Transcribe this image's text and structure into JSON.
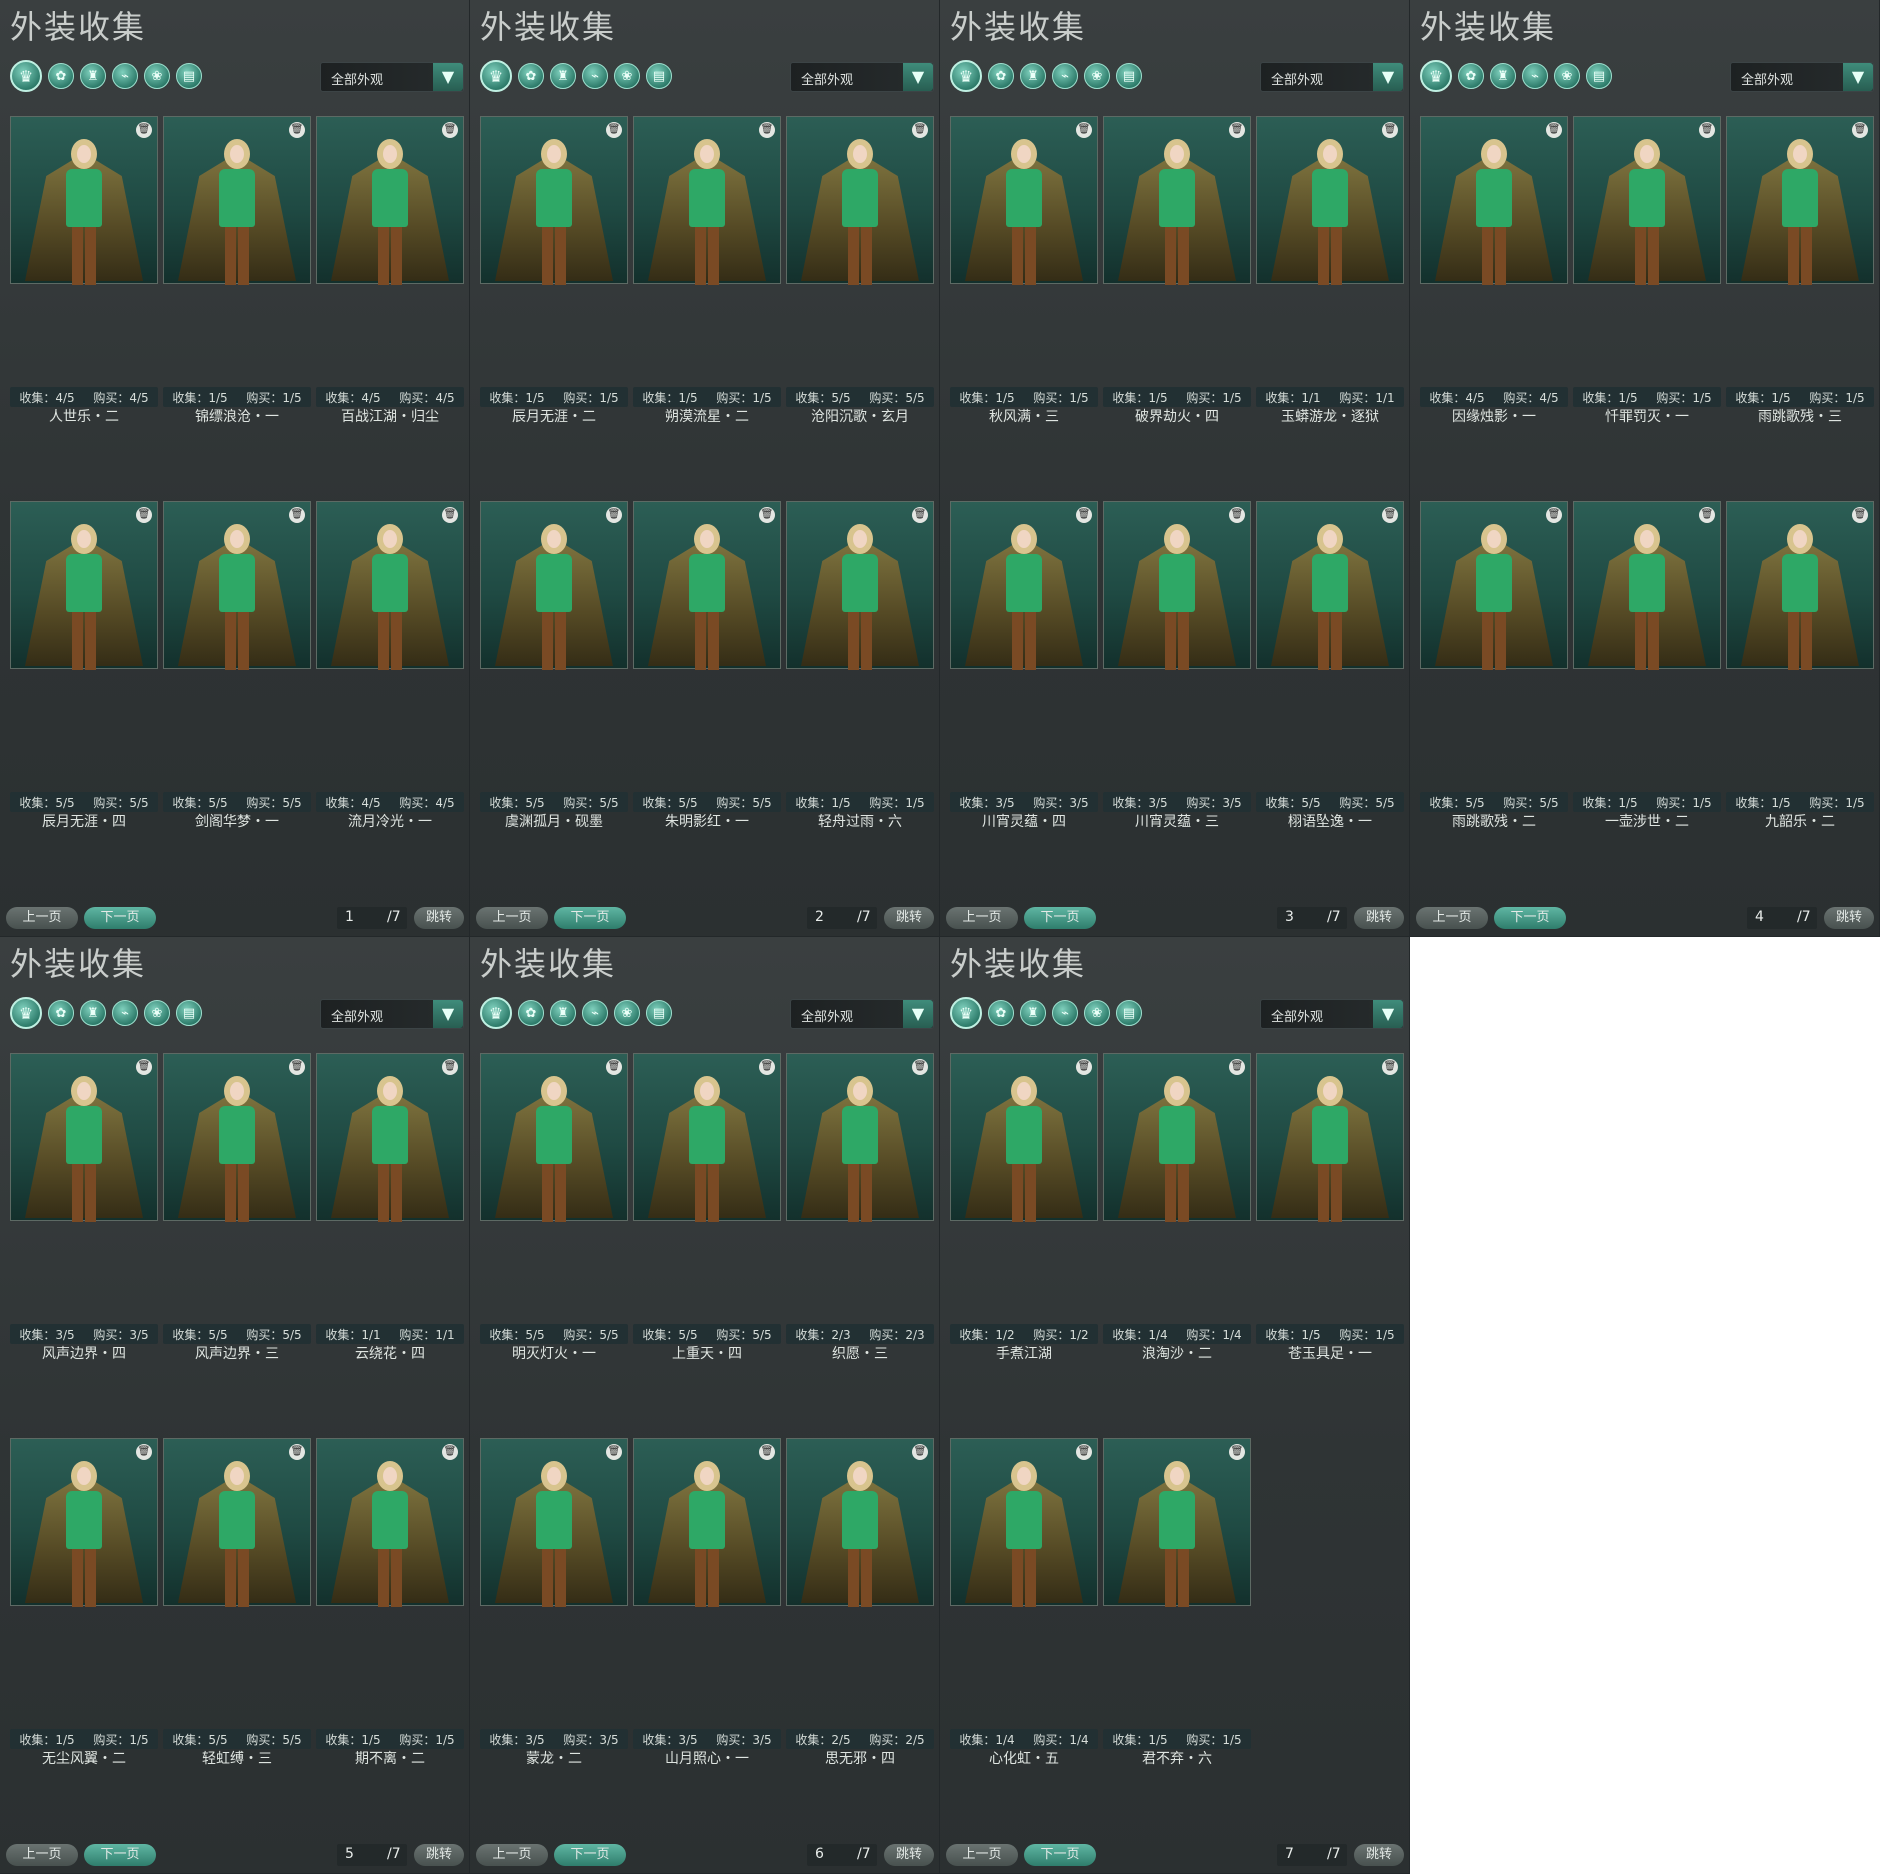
{
  "app": {
    "title": "外装收集",
    "filter_value": "全部外观",
    "prev_label": "上一页",
    "next_label": "下一页",
    "jump_label": "跳转"
  },
  "category_icons": [
    "outfit-icon",
    "hair-icon",
    "top-icon",
    "shoe-icon",
    "pet-icon",
    "scroll-icon"
  ],
  "colors": {
    "accent": "#3f8c7b",
    "panel_bg": "#2f3435",
    "card_bg": "#1f4a43"
  },
  "pages": [
    {
      "page": "1",
      "total": "/7",
      "items": [
        {
          "name": "人世乐・二",
          "collect": "收集：4/5",
          "buy": "购买：4/5"
        },
        {
          "name": "锦缥浪沧・一",
          "collect": "收集：1/5",
          "buy": "购买：1/5"
        },
        {
          "name": "百战江湖・归尘",
          "collect": "收集：4/5",
          "buy": "购买：4/5"
        },
        {
          "name": "辰月无涯・四",
          "collect": "收集：5/5",
          "buy": "购买：5/5"
        },
        {
          "name": "剑阁华梦・一",
          "collect": "收集：5/5",
          "buy": "购买：5/5"
        },
        {
          "name": "流月冷光・一",
          "collect": "收集：4/5",
          "buy": "购买：4/5"
        }
      ]
    },
    {
      "page": "2",
      "total": "/7",
      "items": [
        {
          "name": "辰月无涯・二",
          "collect": "收集：1/5",
          "buy": "购买：1/5"
        },
        {
          "name": "朔漠流星・二",
          "collect": "收集：1/5",
          "buy": "购买：1/5"
        },
        {
          "name": "沧阳沉歌・玄月",
          "collect": "收集：5/5",
          "buy": "购买：5/5"
        },
        {
          "name": "虞渊孤月・砚墨",
          "collect": "收集：5/5",
          "buy": "购买：5/5"
        },
        {
          "name": "朱明影红・一",
          "collect": "收集：5/5",
          "buy": "购买：5/5"
        },
        {
          "name": "轻舟过雨・六",
          "collect": "收集：1/5",
          "buy": "购买：1/5"
        }
      ]
    },
    {
      "page": "3",
      "total": "/7",
      "items": [
        {
          "name": "秋风满・三",
          "collect": "收集：1/5",
          "buy": "购买：1/5"
        },
        {
          "name": "破界劫火・四",
          "collect": "收集：1/5",
          "buy": "购买：1/5"
        },
        {
          "name": "玉蟒游龙・逐狱",
          "collect": "收集：1/1",
          "buy": "购买：1/1"
        },
        {
          "name": "川宵灵蕴・四",
          "collect": "收集：3/5",
          "buy": "购买：3/5"
        },
        {
          "name": "川宵灵蕴・三",
          "collect": "收集：3/5",
          "buy": "购买：3/5"
        },
        {
          "name": "栩语坠逸・一",
          "collect": "收集：5/5",
          "buy": "购买：5/5"
        }
      ]
    },
    {
      "page": "4",
      "total": "/7",
      "items": [
        {
          "name": "因缘烛影・一",
          "collect": "收集：4/5",
          "buy": "购买：4/5"
        },
        {
          "name": "忏罪罚灭・一",
          "collect": "收集：1/5",
          "buy": "购买：1/5"
        },
        {
          "name": "雨跳歌残・三",
          "collect": "收集：1/5",
          "buy": "购买：1/5"
        },
        {
          "name": "雨跳歌残・二",
          "collect": "收集：5/5",
          "buy": "购买：5/5"
        },
        {
          "name": "一壶涉世・二",
          "collect": "收集：1/5",
          "buy": "购买：1/5"
        },
        {
          "name": "九韶乐・二",
          "collect": "收集：1/5",
          "buy": "购买：1/5"
        }
      ]
    },
    {
      "page": "5",
      "total": "/7",
      "items": [
        {
          "name": "风声边界・四",
          "collect": "收集：3/5",
          "buy": "购买：3/5"
        },
        {
          "name": "风声边界・三",
          "collect": "收集：5/5",
          "buy": "购买：5/5"
        },
        {
          "name": "云绕花・四",
          "collect": "收集：1/1",
          "buy": "购买：1/1"
        },
        {
          "name": "无尘风翼・二",
          "collect": "收集：1/5",
          "buy": "购买：1/5"
        },
        {
          "name": "轻虹缚・三",
          "collect": "收集：5/5",
          "buy": "购买：5/5"
        },
        {
          "name": "期不离・二",
          "collect": "收集：1/5",
          "buy": "购买：1/5"
        }
      ]
    },
    {
      "page": "6",
      "total": "/7",
      "items": [
        {
          "name": "明灭灯火・一",
          "collect": "收集：5/5",
          "buy": "购买：5/5"
        },
        {
          "name": "上重天・四",
          "collect": "收集：5/5",
          "buy": "购买：5/5"
        },
        {
          "name": "织愿・三",
          "collect": "收集：2/3",
          "buy": "购买：2/3"
        },
        {
          "name": "蒙龙・二",
          "collect": "收集：3/5",
          "buy": "购买：3/5"
        },
        {
          "name": "山月照心・一",
          "collect": "收集：3/5",
          "buy": "购买：3/5"
        },
        {
          "name": "思无邪・四",
          "collect": "收集：2/5",
          "buy": "购买：2/5"
        }
      ]
    },
    {
      "page": "7",
      "total": "/7",
      "items": [
        {
          "name": "手煮江湖",
          "collect": "收集：1/2",
          "buy": "购买：1/2"
        },
        {
          "name": "浪淘沙・二",
          "collect": "收集：1/4",
          "buy": "购买：1/4"
        },
        {
          "name": "苍玉具足・一",
          "collect": "收集：1/5",
          "buy": "购买：1/5"
        },
        {
          "name": "心化虹・五",
          "collect": "收集：1/4",
          "buy": "购买：1/4"
        },
        {
          "name": "君不弃・六",
          "collect": "收集：1/5",
          "buy": "购买：1/5"
        }
      ]
    }
  ]
}
